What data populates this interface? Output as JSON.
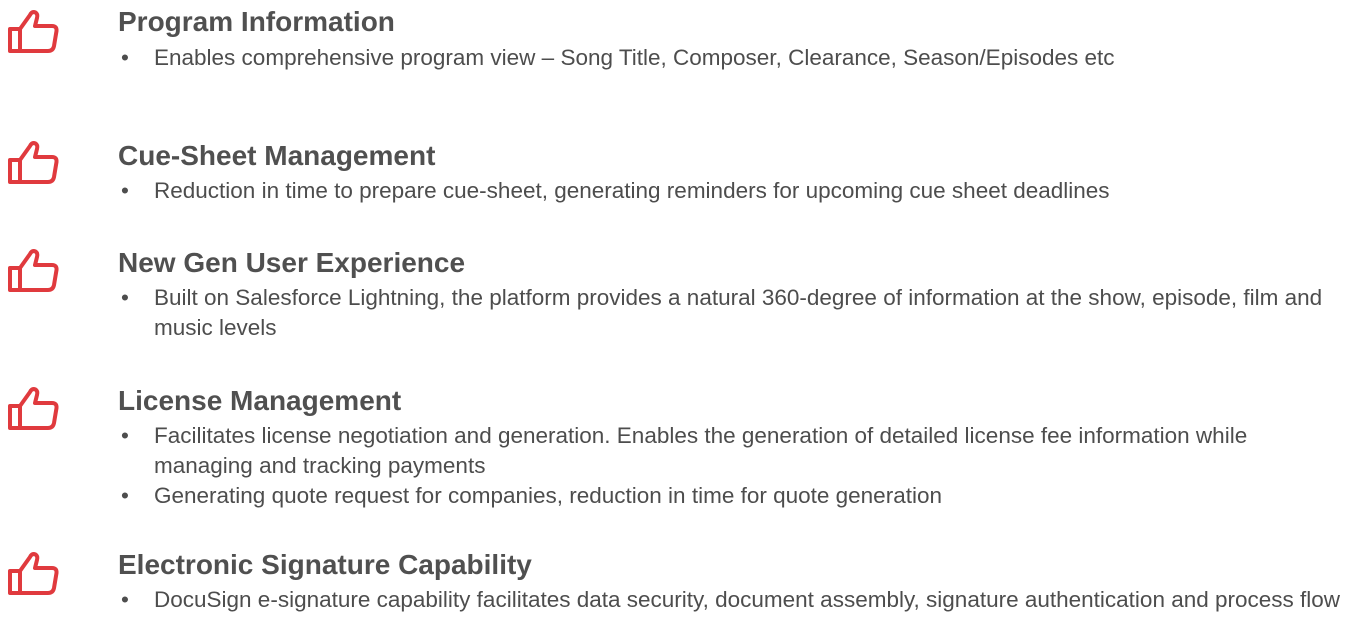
{
  "icon": "thumbs-up-icon",
  "accent_color": "#e03a3e",
  "bullet_char": "•",
  "sections": [
    {
      "title": "Program Information",
      "bullets": [
        "Enables comprehensive program view – Song Title, Composer, Clearance, Season/Episodes etc"
      ]
    },
    {
      "title": "Cue-Sheet Management",
      "bullets": [
        "Reduction in time to prepare cue-sheet, generating reminders for upcoming cue sheet deadlines"
      ]
    },
    {
      "title": "New Gen User Experience",
      "bullets": [
        "Built on Salesforce Lightning, the platform provides a natural 360-degree of information at the show, episode, film and music levels"
      ]
    },
    {
      "title": "License Management",
      "bullets": [
        "Facilitates license negotiation and generation. Enables the generation of detailed license fee information while managing and tracking payments",
        "Generating quote request for companies, reduction in time for quote generation"
      ]
    },
    {
      "title": "Electronic Signature Capability",
      "bullets": [
        "DocuSign e-signature capability facilitates data security, document assembly, signature authentication and process flow"
      ]
    }
  ]
}
